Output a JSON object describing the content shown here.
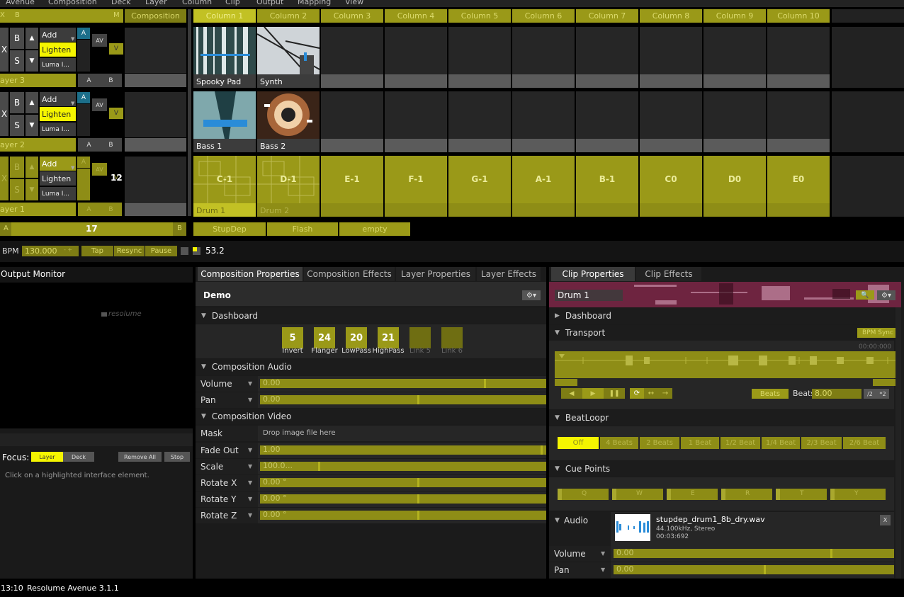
{
  "menu": [
    "Avenue",
    "Composition",
    "Deck",
    "Layer",
    "Column",
    "Clip",
    "Output",
    "Mapping",
    "View"
  ],
  "header": {
    "x": "X",
    "b": "B",
    "m": "M",
    "composition": "Composition"
  },
  "columns": [
    "Column 1",
    "Column 2",
    "Column 3",
    "Column 4",
    "Column 5",
    "Column 6",
    "Column 7",
    "Column 8",
    "Column 9",
    "Column 10"
  ],
  "layers": [
    {
      "name": "ayer 3",
      "x": "X",
      "b": "B",
      "s": "S",
      "blend": [
        "Add",
        "Lighten",
        "Luma I..."
      ],
      "a": "A",
      "av": "AV",
      "v": "V",
      "ab_a": "A",
      "ab_b": "B",
      "clips": [
        "Spooky Pad",
        "Synth"
      ]
    },
    {
      "name": "ayer 2",
      "x": "X",
      "b": "B",
      "s": "S",
      "blend": [
        "Add",
        "Lighten",
        "Luma I..."
      ],
      "a": "A",
      "av": "AV",
      "v": "V",
      "ab_a": "A",
      "ab_b": "B",
      "clips": [
        "Bass 1",
        "Bass 2"
      ]
    },
    {
      "name": "ayer 1",
      "x": "X",
      "b": "B",
      "s": "S",
      "blend": [
        "Add",
        "Lighten",
        "Luma I..."
      ],
      "a": "A",
      "av": "AV",
      "v": "V",
      "num": "12",
      "ab_a": "A",
      "ab_b": "B",
      "clips": [
        "Drum 1",
        "Drum 2"
      ],
      "keys": [
        "C-1",
        "D-1",
        "E-1",
        "F-1",
        "G-1",
        "A-1",
        "B-1",
        "C0",
        "D0",
        "E0"
      ]
    }
  ],
  "crossfader": {
    "a": "A",
    "value": "17",
    "b": "B"
  },
  "decks": [
    "StupDep",
    "Flash",
    "empty"
  ],
  "bpm": {
    "label": "BPM",
    "value": "130.000",
    "tap": "Tap",
    "resync": "Resync",
    "pause": "Pause",
    "counter": "53.2"
  },
  "output_monitor": {
    "title": "Output Monitor",
    "logo": "resolume"
  },
  "focus": {
    "label": "Focus:",
    "layer": "Layer",
    "deck": "Deck",
    "remove_all": "Remove All",
    "stop": "Stop",
    "hint": "Click on a highlighted interface element."
  },
  "status": {
    "time": "13:10",
    "app": "Resolume Avenue 3.1.1"
  },
  "comp_tabs": [
    "Composition Properties",
    "Composition Effects",
    "Layer Properties",
    "Layer Effects"
  ],
  "comp": {
    "name": "Demo",
    "dashboard": "Dashboard",
    "knobs": [
      {
        "v": "5",
        "l": "Invert"
      },
      {
        "v": "24",
        "l": "Flanger"
      },
      {
        "v": "20",
        "l": "LowPass"
      },
      {
        "v": "21",
        "l": "HighPass"
      },
      {
        "v": "",
        "l": "Link 5"
      },
      {
        "v": "",
        "l": "Link 6"
      }
    ],
    "audio": "Composition Audio",
    "volume": {
      "label": "Volume",
      "value": "0.00"
    },
    "pan": {
      "label": "Pan",
      "value": "0.00"
    },
    "video": "Composition Video",
    "mask": {
      "label": "Mask",
      "value": "Drop image file here"
    },
    "fadeout": {
      "label": "Fade Out",
      "value": "1.00"
    },
    "scale": {
      "label": "Scale",
      "value": "100.0..."
    },
    "rotx": {
      "label": "Rotate X",
      "value": "0.00 °"
    },
    "roty": {
      "label": "Rotate Y",
      "value": "0.00 °"
    },
    "rotz": {
      "label": "Rotate Z",
      "value": "0.00 °"
    }
  },
  "clip_tabs": [
    "Clip Properties",
    "Clip Effects"
  ],
  "clip": {
    "name": "Drum 1",
    "dashboard": "Dashboard",
    "transport": "Transport",
    "bpm_sync": "BPM Sync",
    "time": "00:00:000",
    "beats_mode": "Beats",
    "beats_label": "Beats",
    "beats_value": "8.00",
    "div2": "/2",
    "mul2": "*2",
    "beatloopr": "BeatLoopr",
    "loop_btns": [
      "Off",
      "4 Beats",
      "2 Beats",
      "1 Beat",
      "1/2 Beat",
      "1/4 Beat",
      "2/3 Beat",
      "2/6 Beat"
    ],
    "cue_points": "Cue Points",
    "cues": [
      "Q",
      "W",
      "E",
      "R",
      "T",
      "Y"
    ],
    "audio": "Audio",
    "file": "stupdep_drum1_8b_dry.wav",
    "format": "44.100kHz, Stereo",
    "duration": "00:03:692",
    "close": "X",
    "volume": {
      "label": "Volume",
      "value": "0.00"
    },
    "pan": {
      "label": "Pan",
      "value": "0.00"
    }
  },
  "colors": {
    "olive": "#9a9918",
    "yellow": "#f5f500",
    "teal": "#1c6f8a"
  }
}
